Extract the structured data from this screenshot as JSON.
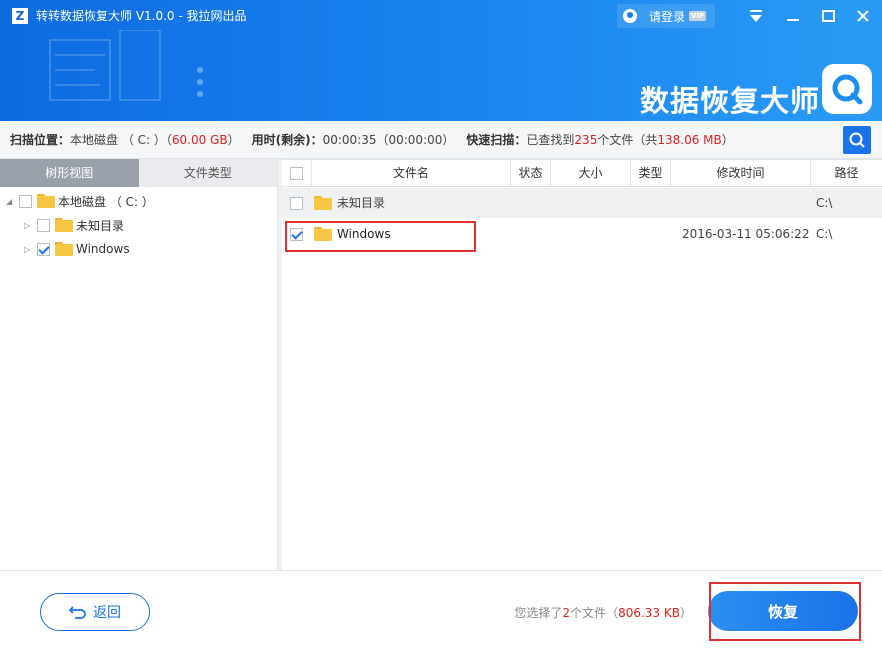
{
  "window": {
    "title": "转转数据恢复大师 V1.0.0 - 我拉网出品",
    "login_label": "请登录",
    "vip_badge": "VIP",
    "brand_text": "数据恢复大师"
  },
  "infobar": {
    "location_label": "扫描位置：",
    "location_value": "本地磁盘 （ C: ）（",
    "location_size": "60.00 GB",
    "location_close": "）",
    "time_label": "用时(剩余)：",
    "time_value": "00:00:35（00:00:00）",
    "scan_label": "快速扫描：",
    "scan_prefix": "已查找到",
    "scan_count": "235",
    "scan_mid": "个文件（共",
    "scan_size": "138.06 MB",
    "scan_close": "）"
  },
  "left_panel": {
    "tabs": [
      {
        "label": "树形视图",
        "active": true
      },
      {
        "label": "文件类型",
        "active": false
      }
    ],
    "tree": [
      {
        "label": "本地磁盘 （ C: ）",
        "checked": false,
        "expanded": true
      },
      {
        "label": "未知目录",
        "checked": false,
        "expanded": false
      },
      {
        "label": "Windows",
        "checked": true,
        "expanded": false
      }
    ]
  },
  "table": {
    "columns": [
      "文件名",
      "状态",
      "大小",
      "类型",
      "修改时间",
      "路径"
    ],
    "rows": [
      {
        "name": "未知目录",
        "status": "",
        "size": "",
        "type": "",
        "modified": "",
        "path": "C:\\",
        "checked": false
      },
      {
        "name": "Windows",
        "status": "",
        "size": "",
        "type": "",
        "modified": "2016-03-11 05:06:22",
        "path": "C:\\",
        "checked": true
      }
    ]
  },
  "footer": {
    "back_label": "返回",
    "select_prefix": "您选择了",
    "select_count": "2",
    "select_mid": "个文件（",
    "select_size": "806.33 KB",
    "select_close": "）",
    "recover_label": "恢复"
  },
  "colors": {
    "accent": "#1a73e8",
    "highlight": "#e03030",
    "folder": "#f7c643"
  }
}
